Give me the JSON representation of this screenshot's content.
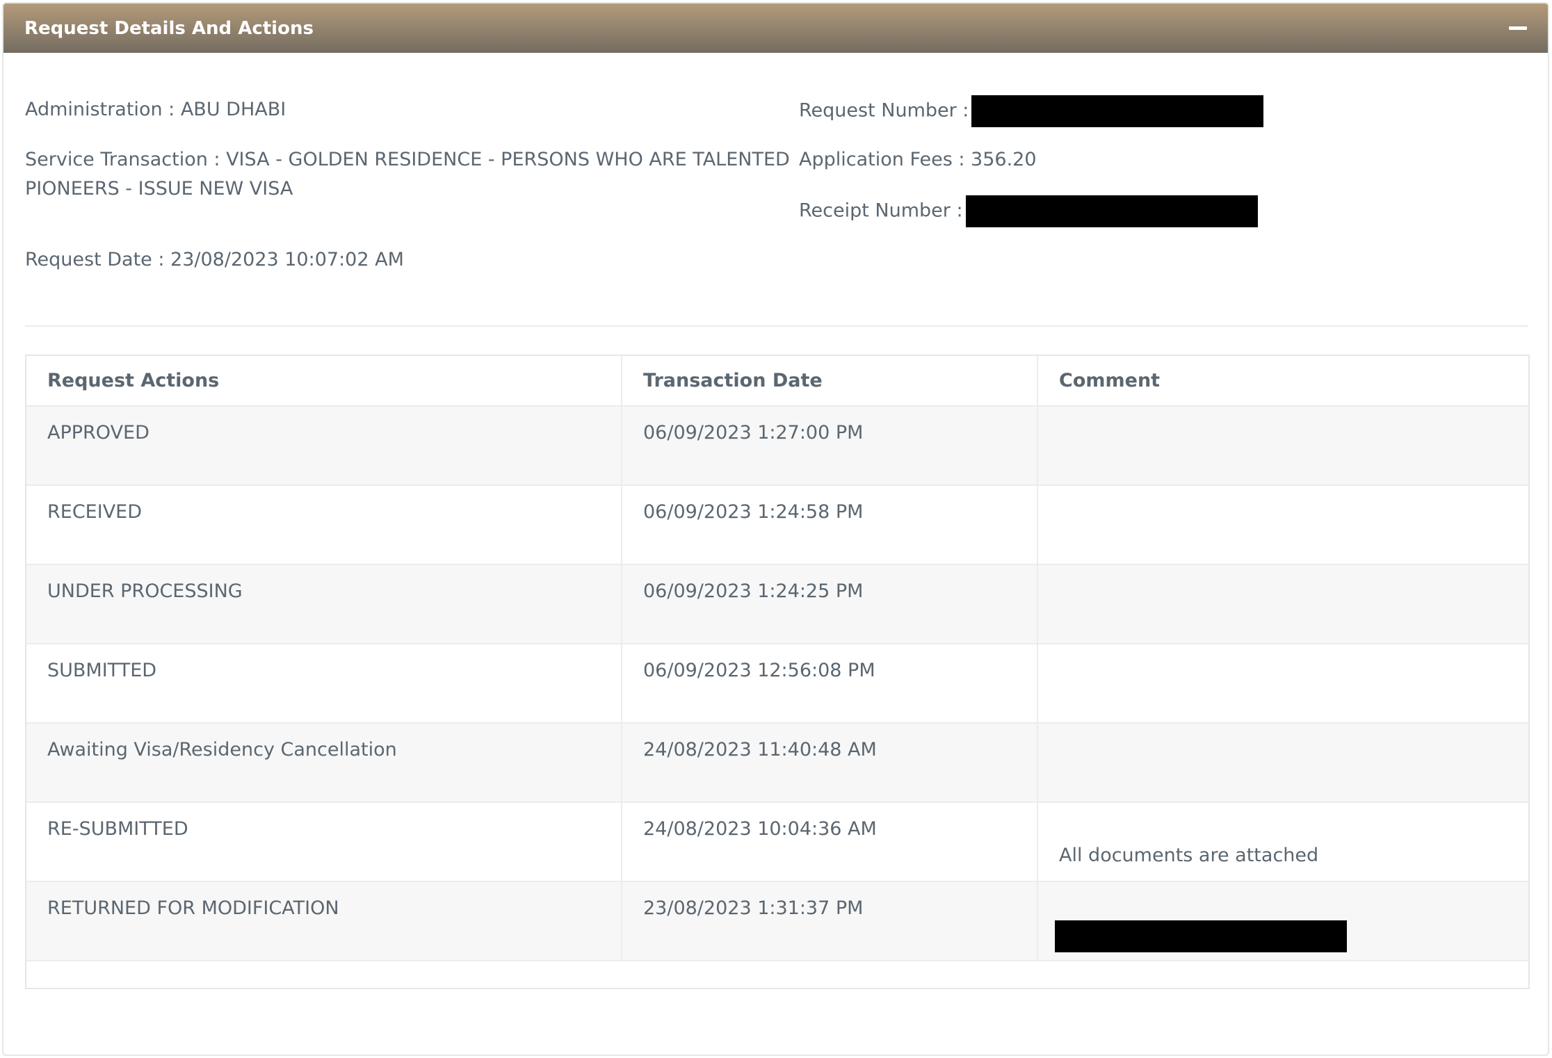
{
  "panel": {
    "title": "Request Details And Actions",
    "collapse_icon": "minus-icon"
  },
  "details": {
    "administration": "Administration : ABU DHABI",
    "service_transaction_line1": "Service Transaction : VISA - GOLDEN RESIDENCE - PERSONS WHO ARE TALENTED",
    "service_transaction_line2": "PIONEERS - ISSUE NEW VISA",
    "request_date": "Request Date : 23/08/2023 10:07:02 AM",
    "request_number_label": "Request Number :",
    "application_fees": "Application Fees : 356.20",
    "receipt_number_label": "Receipt Number :"
  },
  "table": {
    "headers": [
      "Request Actions",
      "Transaction Date",
      "Comment"
    ],
    "rows": [
      {
        "action": "APPROVED",
        "date": "06/09/2023 1:27:00 PM",
        "comment": ""
      },
      {
        "action": "RECEIVED",
        "date": "06/09/2023 1:24:58 PM",
        "comment": ""
      },
      {
        "action": "UNDER PROCESSING",
        "date": "06/09/2023 1:24:25 PM",
        "comment": ""
      },
      {
        "action": "SUBMITTED",
        "date": "06/09/2023 12:56:08 PM",
        "comment": ""
      },
      {
        "action": "Awaiting Visa/Residency Cancellation",
        "date": "24/08/2023 11:40:48 AM",
        "comment": ""
      },
      {
        "action": "RE-SUBMITTED",
        "date": "24/08/2023 10:04:36 AM",
        "comment": "All documents are attached"
      },
      {
        "action": "RETURNED FOR MODIFICATION",
        "date": "23/08/2023 1:31:37 PM",
        "comment": ""
      }
    ]
  },
  "colors": {
    "header_gradient_top": "#b39b7a",
    "header_gradient_bottom": "#746c61",
    "text": "#5b6670",
    "stripe": "#f7f7f7"
  }
}
